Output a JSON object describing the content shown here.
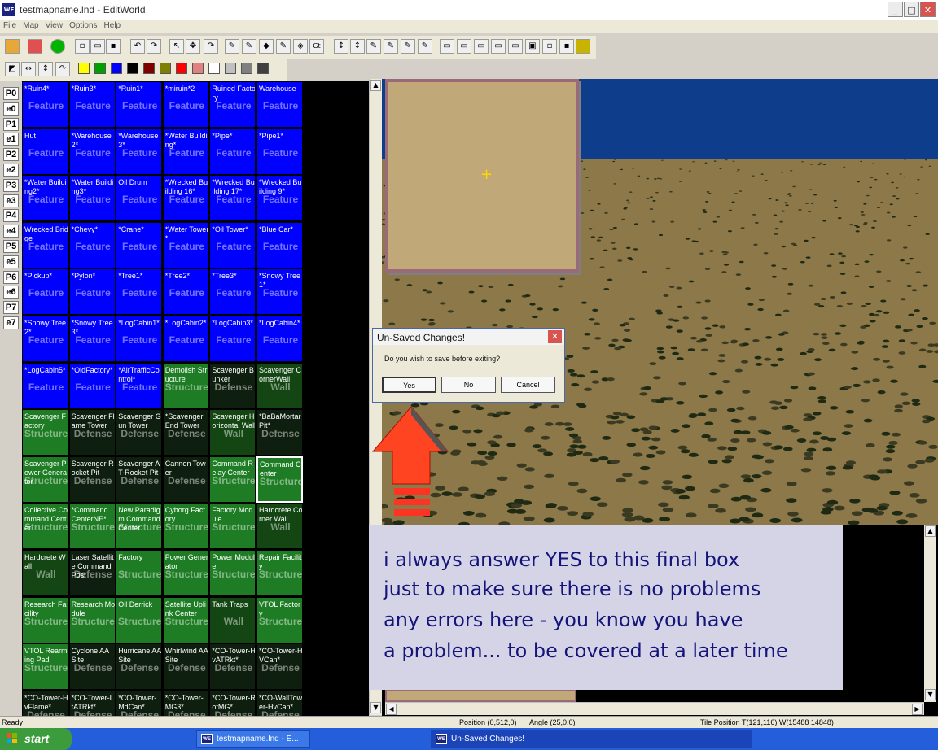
{
  "window": {
    "title": "testmapname.lnd - EditWorld",
    "app_icon": "WE",
    "minimize": "_",
    "maximize": "□",
    "close": "✕"
  },
  "menu": [
    "File",
    "Map",
    "View",
    "Options",
    "Help"
  ],
  "player_tabs": [
    "P0",
    "e0",
    "P1",
    "e1",
    "P2",
    "e2",
    "P3",
    "e3",
    "P4",
    "e4",
    "P5",
    "e5",
    "P6",
    "e6",
    "P7",
    "e7"
  ],
  "colors": {
    "feature": "#0000ff",
    "structure": "#1e7d24",
    "defense": "#0f1f0f",
    "note_text": "#14147a",
    "sky": "#0e3d8c"
  },
  "palette_colors": [
    "#ffff00",
    "#00a000",
    "#0000ff",
    "#000000",
    "#800000",
    "#808000",
    "#ff0000",
    "#e08080",
    "#ffffff",
    "#c0c0c0",
    "#808080",
    "#404040"
  ],
  "grid": [
    [
      {
        "name": "*Ruin4*",
        "type": "Feature",
        "kind": "feature"
      },
      {
        "name": "*Ruin3*",
        "type": "Feature",
        "kind": "feature"
      },
      {
        "name": "*Ruin1*",
        "type": "Feature",
        "kind": "feature"
      },
      {
        "name": "*miruin*2",
        "type": "Feature",
        "kind": "feature"
      },
      {
        "name": "Ruined Factory",
        "type": "Feature",
        "kind": "feature"
      },
      {
        "name": "Warehouse",
        "type": "Feature",
        "kind": "feature"
      }
    ],
    [
      {
        "name": "Hut",
        "type": "Feature",
        "kind": "feature"
      },
      {
        "name": "*Warehouse2*",
        "type": "Feature",
        "kind": "feature"
      },
      {
        "name": "*Warehouse3*",
        "type": "Feature",
        "kind": "feature"
      },
      {
        "name": "*Water Building*",
        "type": "Feature",
        "kind": "feature"
      },
      {
        "name": "*Pipe*",
        "type": "Feature",
        "kind": "feature"
      },
      {
        "name": "*Pipe1*",
        "type": "Feature",
        "kind": "feature"
      }
    ],
    [
      {
        "name": "*Water Building2*",
        "type": "Feature",
        "kind": "feature"
      },
      {
        "name": "*Water Building3*",
        "type": "Feature",
        "kind": "feature"
      },
      {
        "name": "Oil Drum",
        "type": "Feature",
        "kind": "feature"
      },
      {
        "name": "*Wrecked Building 16*",
        "type": "Feature",
        "kind": "feature"
      },
      {
        "name": "*Wrecked Building 17*",
        "type": "Feature",
        "kind": "feature"
      },
      {
        "name": "*Wrecked Building 9*",
        "type": "Feature",
        "kind": "feature"
      }
    ],
    [
      {
        "name": "Wrecked Bridge",
        "type": "Feature",
        "kind": "feature"
      },
      {
        "name": "*Chevy*",
        "type": "Feature",
        "kind": "feature"
      },
      {
        "name": "*Crane*",
        "type": "Feature",
        "kind": "feature"
      },
      {
        "name": "*Water Tower*",
        "type": "Feature",
        "kind": "feature"
      },
      {
        "name": "*Oil Tower*",
        "type": "Feature",
        "kind": "feature"
      },
      {
        "name": "*Blue Car*",
        "type": "Feature",
        "kind": "feature"
      }
    ],
    [
      {
        "name": "*Pickup*",
        "type": "Feature",
        "kind": "feature"
      },
      {
        "name": "*Pylon*",
        "type": "Feature",
        "kind": "feature"
      },
      {
        "name": "*Tree1*",
        "type": "Feature",
        "kind": "feature"
      },
      {
        "name": "*Tree2*",
        "type": "Feature",
        "kind": "feature"
      },
      {
        "name": "*Tree3*",
        "type": "Feature",
        "kind": "feature"
      },
      {
        "name": "*Snowy Tree1*",
        "type": "Feature",
        "kind": "feature"
      }
    ],
    [
      {
        "name": "*Snowy Tree2*",
        "type": "Feature",
        "kind": "feature"
      },
      {
        "name": "*Snowy Tree3*",
        "type": "Feature",
        "kind": "feature"
      },
      {
        "name": "*LogCabin1*",
        "type": "Feature",
        "kind": "feature"
      },
      {
        "name": "*LogCabin2*",
        "type": "Feature",
        "kind": "feature"
      },
      {
        "name": "*LogCabin3*",
        "type": "Feature",
        "kind": "feature"
      },
      {
        "name": "*LogCabin4*",
        "type": "Feature",
        "kind": "feature"
      }
    ],
    [
      {
        "name": "*LogCabin5*",
        "type": "Feature",
        "kind": "feature"
      },
      {
        "name": "*OldFactory*",
        "type": "Feature",
        "kind": "feature"
      },
      {
        "name": "*AirTrafficControl*",
        "type": "Feature",
        "kind": "feature"
      },
      {
        "name": "Demolish Structure",
        "type": "Structure",
        "kind": "structure"
      },
      {
        "name": "Scavenger Bunker",
        "type": "Defense",
        "kind": "defense"
      },
      {
        "name": "Scavenger CornerWall",
        "type": "Wall",
        "kind": "wall"
      }
    ],
    [
      {
        "name": "Scavenger Factory",
        "type": "Structure",
        "kind": "structure"
      },
      {
        "name": "Scavenger Flame Tower",
        "type": "Defense",
        "kind": "defense"
      },
      {
        "name": "Scavenger Gun Tower",
        "type": "Defense",
        "kind": "defense"
      },
      {
        "name": "*Scavenger End Tower",
        "type": "Defense",
        "kind": "defense"
      },
      {
        "name": "Scavenger Horizontal Wall",
        "type": "Wall",
        "kind": "wall"
      },
      {
        "name": "*BaBaMortarPit*",
        "type": "Defense",
        "kind": "defense"
      }
    ],
    [
      {
        "name": "Scavenger Power Generator",
        "type": "Structure",
        "kind": "structure"
      },
      {
        "name": "Scavenger Rocket Pit",
        "type": "Defense",
        "kind": "defense"
      },
      {
        "name": "Scavenger AT-Rocket Pit",
        "type": "Defense",
        "kind": "defense"
      },
      {
        "name": "Cannon Tower",
        "type": "Defense",
        "kind": "defense"
      },
      {
        "name": "Command Relay Center",
        "type": "Structure",
        "kind": "structure"
      },
      {
        "name": "Command Center",
        "type": "Structure",
        "kind": "structure",
        "selected": true
      }
    ],
    [
      {
        "name": "Collective Command Center",
        "type": "Structure",
        "kind": "structure"
      },
      {
        "name": "*Command CenterNE*",
        "type": "Structure",
        "kind": "structure"
      },
      {
        "name": "New Paradigm Command Center",
        "type": "Structure",
        "kind": "structure"
      },
      {
        "name": "Cyborg Factory",
        "type": "Structure",
        "kind": "structure"
      },
      {
        "name": "Factory Module",
        "type": "Structure",
        "kind": "structure"
      },
      {
        "name": "Hardcrete Corner Wall",
        "type": "Wall",
        "kind": "wall"
      }
    ],
    [
      {
        "name": "Hardcrete Wall",
        "type": "Wall",
        "kind": "wall"
      },
      {
        "name": "Laser Satellite Command Post",
        "type": "Defense",
        "kind": "defense"
      },
      {
        "name": "Factory",
        "type": "Structure",
        "kind": "structure"
      },
      {
        "name": "Power Generator",
        "type": "Structure",
        "kind": "structure"
      },
      {
        "name": "Power Module",
        "type": "Structure",
        "kind": "structure"
      },
      {
        "name": "Repair Facility",
        "type": "Structure",
        "kind": "structure"
      }
    ],
    [
      {
        "name": "Research Facility",
        "type": "Structure",
        "kind": "structure"
      },
      {
        "name": "Research Module",
        "type": "Structure",
        "kind": "structure"
      },
      {
        "name": "Oil Derrick",
        "type": "Structure",
        "kind": "structure"
      },
      {
        "name": "Satellite Uplink Center",
        "type": "Structure",
        "kind": "structure"
      },
      {
        "name": "Tank Traps",
        "type": "Wall",
        "kind": "wall"
      },
      {
        "name": "VTOL Factory",
        "type": "Structure",
        "kind": "structure"
      }
    ],
    [
      {
        "name": "VTOL Rearming Pad",
        "type": "Structure",
        "kind": "structure"
      },
      {
        "name": "Cyclone AA Site",
        "type": "Defense",
        "kind": "defense"
      },
      {
        "name": "Hurricane AA Site",
        "type": "Defense",
        "kind": "defense"
      },
      {
        "name": "Whirlwind AA Site",
        "type": "Defense",
        "kind": "defense"
      },
      {
        "name": "*CO-Tower-HvATRkt*",
        "type": "Defense",
        "kind": "defense"
      },
      {
        "name": "*CO-Tower-HVCan*",
        "type": "Defense",
        "kind": "defense"
      }
    ],
    [
      {
        "name": "*CO-Tower-HvFlame*",
        "type": "Defense",
        "kind": "defense"
      },
      {
        "name": "*CO-Tower-LtATRkt*",
        "type": "Defense",
        "kind": "defense"
      },
      {
        "name": "*CO-Tower-MdCan*",
        "type": "Defense",
        "kind": "defense"
      },
      {
        "name": "*CO-Tower-MG3*",
        "type": "Defense",
        "kind": "defense"
      },
      {
        "name": "*CO-Tower-RotMG*",
        "type": "Defense",
        "kind": "defense"
      },
      {
        "name": "*CO-WallTower-HvCan*",
        "type": "Defense",
        "kind": "defense"
      }
    ]
  ],
  "dialog": {
    "title": "Un-Saved Changes!",
    "close": "✕",
    "message": "Do you wish to save before exiting?",
    "yes": "Yes",
    "no": "No",
    "cancel": "Cancel"
  },
  "annotation": {
    "lines": [
      "i always answer YES to this final box",
      "just to make sure there is no problems",
      "any errors here - you know you have",
      "a problem... to be covered at a later time"
    ]
  },
  "status": {
    "left": "Ready",
    "position": "Position (0,512,0)",
    "angle": "Angle (25,0,0)",
    "tile": "Tile Position T(121,116) W(15488 14848)"
  },
  "taskbar": {
    "start": "start",
    "items": [
      {
        "label": "testmapname.lnd - E...",
        "icon": "WE"
      },
      {
        "label": "Un-Saved Changes!",
        "icon": "WE",
        "active": true
      }
    ]
  },
  "crosshair": "+"
}
